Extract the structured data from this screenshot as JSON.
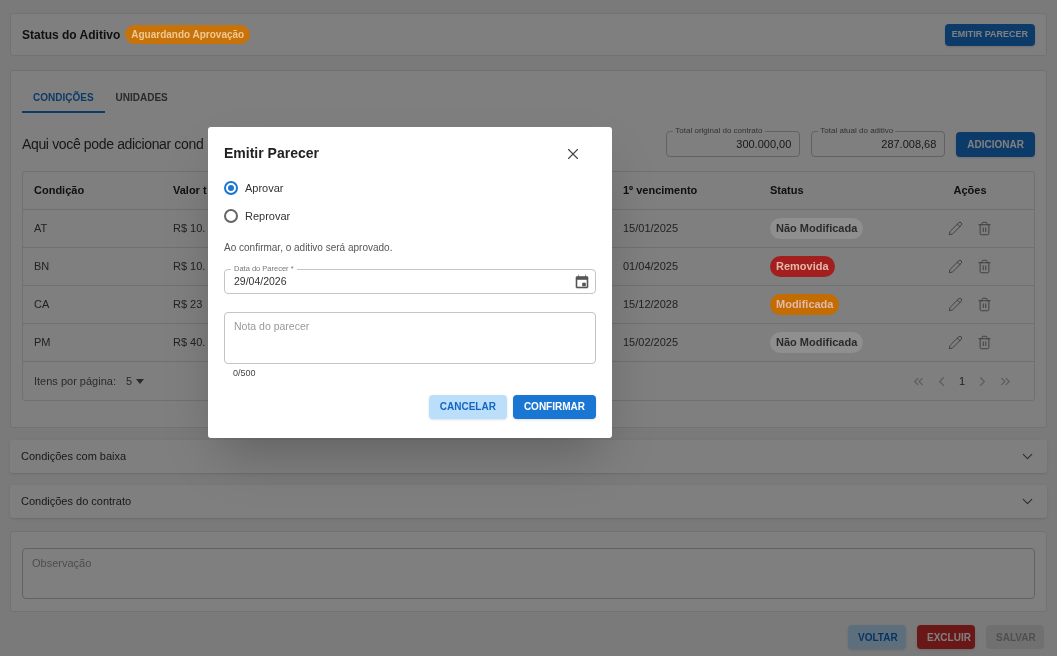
{
  "header": {
    "title": "Status do Aditivo",
    "status_badge": {
      "label": "Aguardando Aprovação",
      "color": "#c8720a"
    },
    "button": "EMITIR PARECER"
  },
  "tabs": [
    {
      "label": "CONDIÇÕES",
      "selected": true
    },
    {
      "label": "UNIDADES",
      "selected": false
    }
  ],
  "section": {
    "heading": "Aqui você pode adicionar cond",
    "total_original": {
      "label": "Total original do contrato",
      "value": "300.000,00"
    },
    "total_atual": {
      "label": "Total atual do aditivo",
      "value": "287.008,68"
    },
    "add_button": "ADICIONAR"
  },
  "table": {
    "columns": [
      "Condição",
      "Valor t",
      "1º vencimento",
      "Status",
      "Ações"
    ],
    "rows": [
      {
        "condicao": "AT",
        "valor": "R$ 10.",
        "vencimento": "15/01/2025",
        "status": {
          "label": "Não Modificada",
          "color": "#8f8f8f"
        }
      },
      {
        "condicao": "BN",
        "valor": "R$ 10.",
        "vencimento": "01/04/2025",
        "status": {
          "label": "Removida",
          "color": "#a31f1f"
        }
      },
      {
        "condicao": "CA",
        "valor": "R$ 23",
        "vencimento": "15/12/2028",
        "status": {
          "label": "Modificada",
          "color": "#c26c02"
        }
      },
      {
        "condicao": "PM",
        "valor": "R$ 40.",
        "vencimento": "15/02/2025",
        "status": {
          "label": "Não Modificada",
          "color": "#8f8f8f"
        }
      }
    ],
    "footer": {
      "items_per_page_label": "Itens por página:",
      "items_per_page": "5",
      "page": "1"
    }
  },
  "accordions": [
    {
      "title": "Condições com baixa",
      "expanded": false
    },
    {
      "title": "Condições do contrato",
      "expanded": false
    }
  ],
  "observacao": {
    "placeholder": "Observação"
  },
  "footer_buttons": [
    {
      "label": "VOLTAR",
      "kind": "secondary"
    },
    {
      "label": "EXCLUIR",
      "kind": "danger"
    },
    {
      "label": "SALVAR",
      "kind": "disabled"
    }
  ],
  "dialog": {
    "title": "Emitir Parecer",
    "options": [
      {
        "label": "Aprovar",
        "selected": true
      },
      {
        "label": "Reprovar",
        "selected": false
      }
    ],
    "message": "Ao confirmar, o aditivo será aprovado.",
    "date_field": {
      "label": "Data do Parecer *",
      "value": "29/04/2026"
    },
    "note_field": {
      "placeholder": "Nota do parecer"
    },
    "counter": "0/500",
    "buttons": [
      {
        "label": "CANCELAR",
        "kind": "secondary"
      },
      {
        "label": "CONFIRMAR",
        "kind": "primary"
      }
    ]
  }
}
